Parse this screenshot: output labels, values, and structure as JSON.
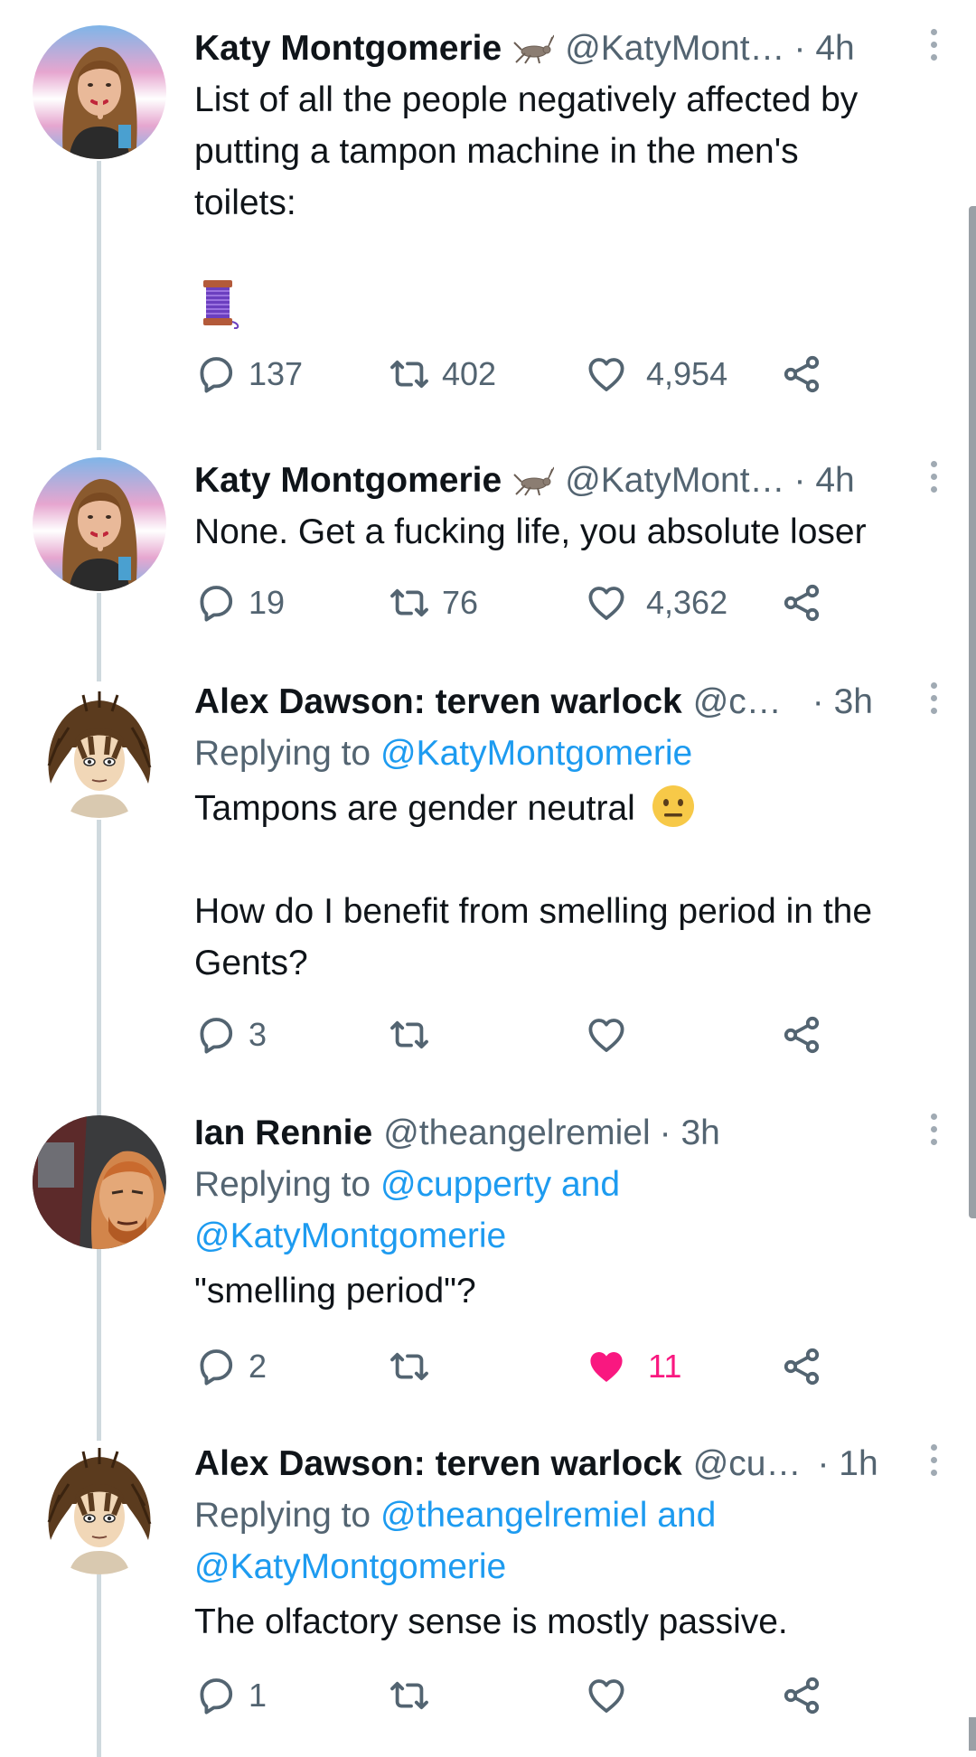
{
  "tweets": [
    {
      "name": "Katy Montgomerie",
      "handle": "@KatyMont…",
      "time": "· 4h",
      "has_cricket": true,
      "text_lines": [
        "List of all the people negatively affected by",
        "putting a tampon machine in the men's",
        "toilets:"
      ],
      "emoji": "🧵",
      "replies": "137",
      "retweets": "402",
      "likes": "4,954",
      "liked": false
    },
    {
      "name": "Katy Montgomerie",
      "handle": "@KatyMont…",
      "time": "· 4h",
      "has_cricket": true,
      "text": "None. Get a fucking life, you absolute loser",
      "replies": "19",
      "retweets": "76",
      "likes": "4,362",
      "liked": false
    },
    {
      "name": "Alex Dawson: terven warlock",
      "handle": "@c…",
      "time": "· 3h",
      "replying_prefix": "Replying to",
      "replying_to": "@KatyMontgomerie",
      "text_line1": "Tampons are gender neutral",
      "text_line2": "How do I benefit from smelling period in the",
      "text_line3": "Gents?",
      "replies": "3",
      "retweets": "",
      "likes": "",
      "liked": false
    },
    {
      "name": "Ian Rennie",
      "handle": "@theangelremiel",
      "time": "· 3h",
      "replying_prefix": "Replying to",
      "replying_to_line1": "@cupperty and",
      "replying_to_line2": "@KatyMontgomerie",
      "text": "\"smelling period\"?",
      "replies": "2",
      "retweets": "",
      "likes": "11",
      "liked": true
    },
    {
      "name": "Alex Dawson: terven warlock",
      "handle": "@cu…",
      "time": "· 1h",
      "replying_prefix": "Replying to",
      "replying_to_line1": "@theangelremiel and",
      "replying_to_line2": "@KatyMontgomerie",
      "text": "The olfactory sense is mostly passive.",
      "replies": "1",
      "retweets": "",
      "likes": "",
      "liked": false
    }
  ],
  "icons": {
    "reply": "reply-icon",
    "retweet": "retweet-icon",
    "like": "heart-icon",
    "share": "share-icon",
    "more": "more-options-icon"
  },
  "colors": {
    "text": "#0f1419",
    "secondary": "#536471",
    "link": "#1d9bf0",
    "like_active": "#f91880",
    "thread_line": "#cfd9de"
  }
}
